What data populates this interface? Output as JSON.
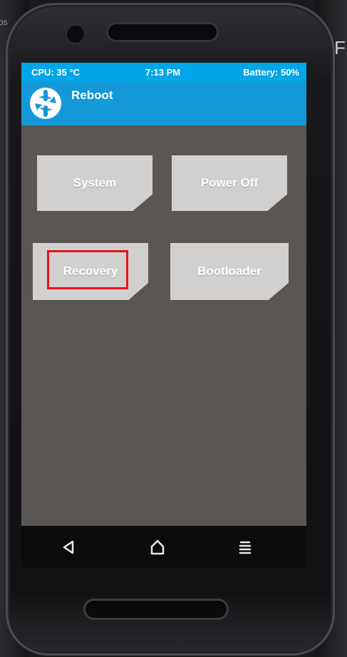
{
  "background": {
    "right_letter": "F",
    "left_text": "os"
  },
  "status_bar": {
    "cpu": "CPU: 35 °C",
    "time": "7:13 PM",
    "battery": "Battery: 50%"
  },
  "header": {
    "title": "Reboot",
    "logo_icon": "twrp-logo-icon"
  },
  "buttons": {
    "system": "System",
    "power_off": "Power Off",
    "recovery": "Recovery",
    "bootloader": "Bootloader"
  },
  "highlight": {
    "target": "recovery",
    "color": "#e1141b"
  },
  "navbar": {
    "icons": [
      "back-icon",
      "home-icon",
      "menu-icon"
    ]
  },
  "colors": {
    "status_bar": "#00a6e8",
    "header": "#1598d8",
    "screen_bg": "#5a5653",
    "button_bg": "#d2d0ce"
  }
}
